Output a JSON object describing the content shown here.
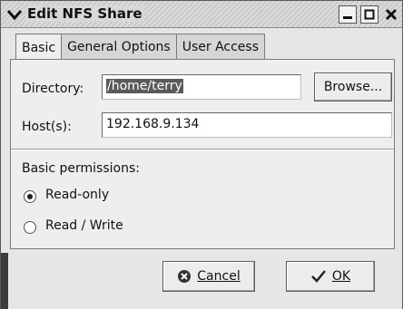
{
  "window": {
    "title": "Edit NFS Share"
  },
  "tabs": [
    {
      "label": "Basic",
      "active": true
    },
    {
      "label": "General Options",
      "active": false
    },
    {
      "label": "User Access",
      "active": false
    }
  ],
  "form": {
    "directory_label": "Directory:",
    "directory_value": "/home/terry",
    "browse_label": "Browse...",
    "hosts_label": "Host(s):",
    "hosts_value": "192.168.9.134"
  },
  "permissions": {
    "heading": "Basic permissions:",
    "options": [
      {
        "label": "Read-only",
        "selected": true
      },
      {
        "label": "Read / Write",
        "selected": false
      }
    ]
  },
  "buttons": {
    "cancel_label": "Cancel",
    "ok_label": "OK"
  }
}
